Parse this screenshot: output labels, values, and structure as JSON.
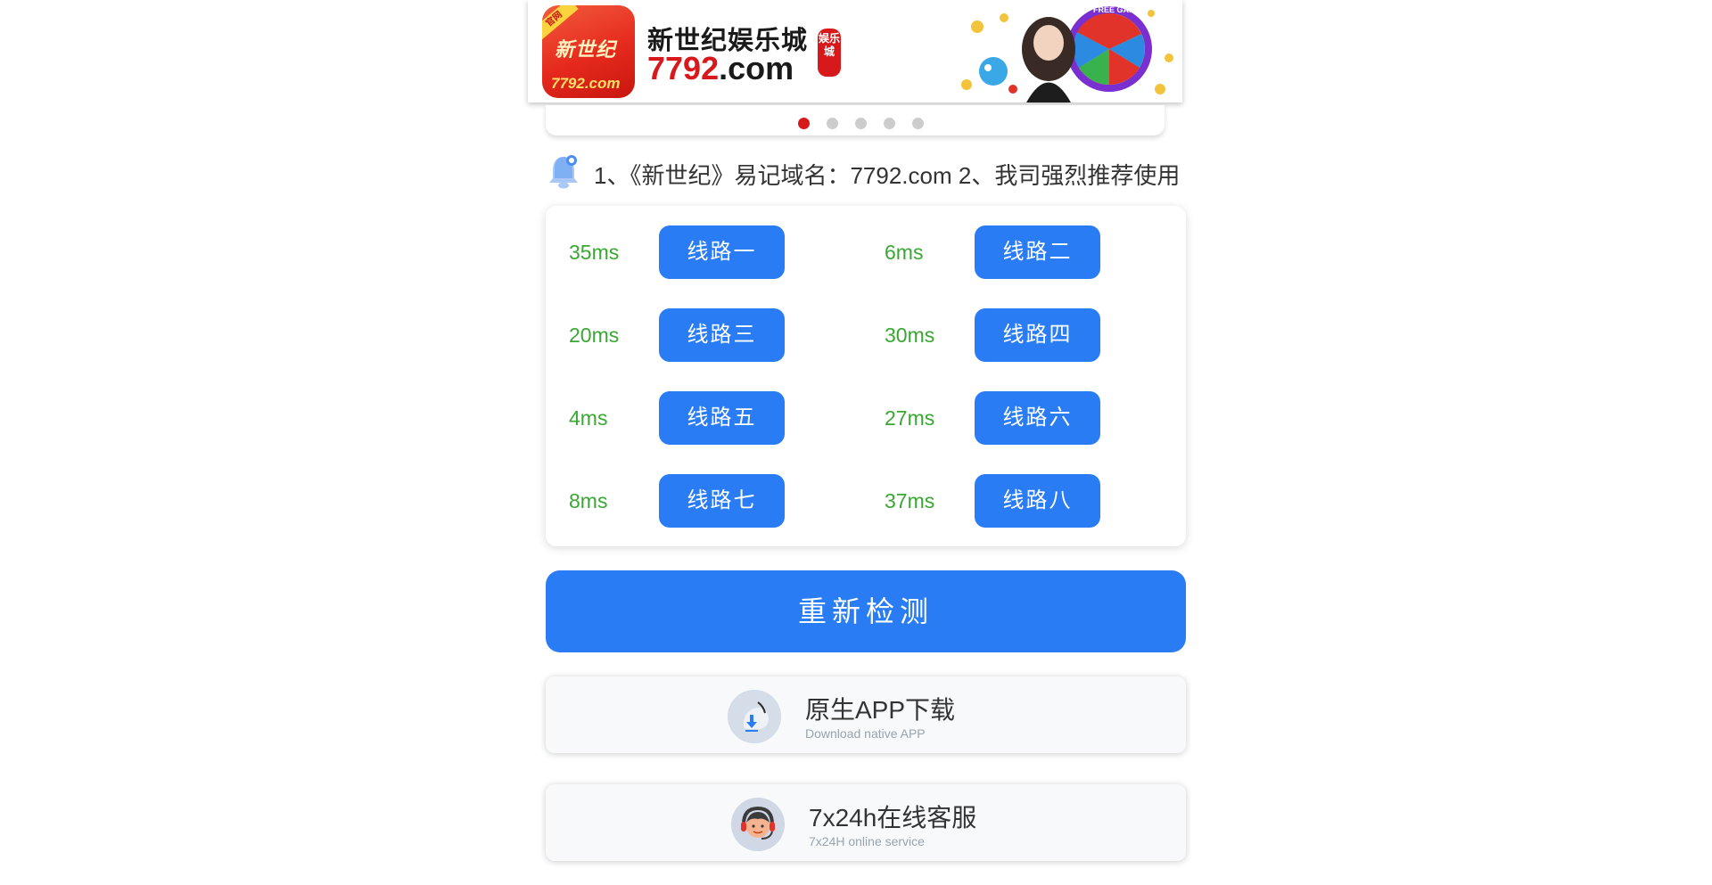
{
  "banner": {
    "logo_tag": "官网",
    "logo_brand": "新世纪",
    "logo_url": "7792.com",
    "title": "新世纪娱乐城",
    "domain_number": "7792",
    "domain_suffix": ".com",
    "seal_text": "娱乐城",
    "art_badge": "FREE GAME"
  },
  "carousel": {
    "dots": [
      {
        "active": true
      },
      {
        "active": false
      },
      {
        "active": false
      },
      {
        "active": false
      },
      {
        "active": false
      }
    ],
    "active_color": "#d7191c",
    "inactive_color": "#cccccc"
  },
  "notice": {
    "icon": "bell-icon",
    "text": "1、《新世纪》易记域名：7792.com 2、我司强烈推荐使用"
  },
  "lines": [
    {
      "latency": "35ms",
      "label": "线路一"
    },
    {
      "latency": "6ms",
      "label": "线路二"
    },
    {
      "latency": "20ms",
      "label": "线路三"
    },
    {
      "latency": "30ms",
      "label": "线路四"
    },
    {
      "latency": "4ms",
      "label": "线路五"
    },
    {
      "latency": "27ms",
      "label": "线路六"
    },
    {
      "latency": "8ms",
      "label": "线路七"
    },
    {
      "latency": "37ms",
      "label": "线路八"
    }
  ],
  "recheck_label": "重新检测",
  "app_download": {
    "icon": "download-icon",
    "title": "原生APP下载",
    "subtitle": "Download native APP"
  },
  "support": {
    "icon": "customer-service-icon",
    "title": "7x24h在线客服",
    "subtitle": "7x24H online service"
  },
  "colors": {
    "primary": "#2a7cf5",
    "latency": "#38a832",
    "brand_red": "#d7191c"
  }
}
